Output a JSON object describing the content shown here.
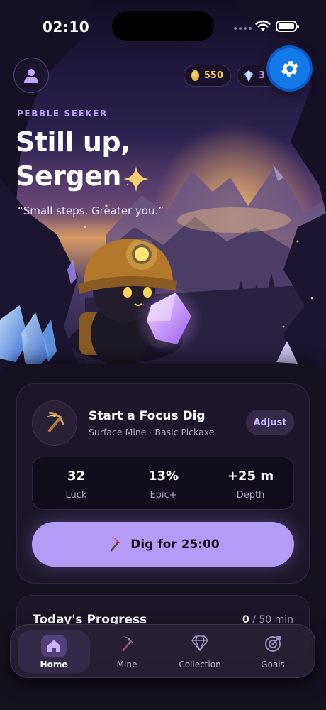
{
  "status": {
    "time": "02:10"
  },
  "header": {
    "coins": "550",
    "gems": "3"
  },
  "hero": {
    "eyebrow": "PEBBLE SEEKER",
    "greeting_line1": "Still up,",
    "greeting_line2": "Sergen",
    "quote": "“Small steps. Greater you.”"
  },
  "focus_card": {
    "title": "Start a Focus Dig",
    "subtitle": "Surface Mine · Basic Pickaxe",
    "adjust_label": "Adjust",
    "stats": [
      {
        "value": "32",
        "label": "Luck"
      },
      {
        "value": "13%",
        "label": "Epic+"
      },
      {
        "value": "+25 m",
        "label": "Depth"
      }
    ],
    "dig_label": "Dig for 25:00"
  },
  "progress": {
    "title": "Today's Progress",
    "current": "0",
    "goal": " / 50 min"
  },
  "tabs": [
    {
      "label": "Home",
      "icon": "home-icon",
      "active": true
    },
    {
      "label": "Mine",
      "icon": "pickaxe-icon",
      "active": false
    },
    {
      "label": "Collection",
      "icon": "diamond-icon",
      "active": false
    },
    {
      "label": "Goals",
      "icon": "target-icon",
      "active": false
    }
  ],
  "colors": {
    "accent": "#b49bf6",
    "settings_button": "#1479e8",
    "coin": "#f6c659",
    "background": "#16111f"
  }
}
